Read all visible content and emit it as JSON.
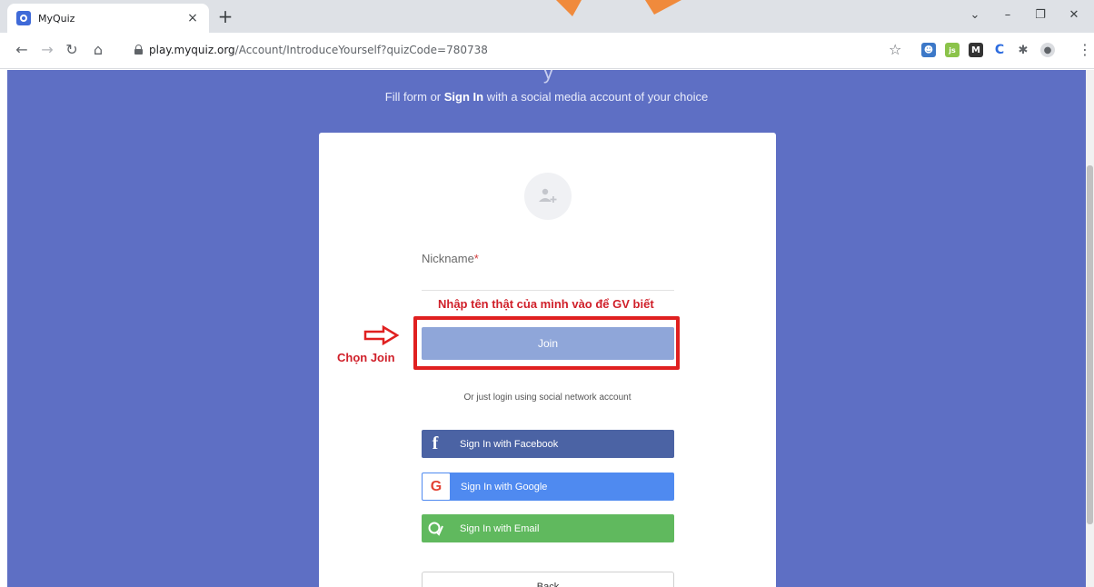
{
  "browser": {
    "tab_title": "MyQuiz",
    "tab_close": "×",
    "new_tab": "+",
    "url_host": "play.myquiz.org",
    "url_path": "/Account/IntroduceYourself?quizCode=780738",
    "window_controls": [
      "⌄",
      "–",
      "❐",
      "✕"
    ],
    "nav_icons": [
      "back-icon",
      "forward-icon",
      "reload-icon",
      "home-icon"
    ],
    "extensions": [
      "person-ext-icon",
      "js-ext-icon",
      "m-ext-icon",
      "c-ext-icon",
      "puzzle-ext-icon",
      "profile-icon"
    ]
  },
  "page": {
    "subtitle_before": "Fill form or ",
    "subtitle_bold": "Sign In",
    "subtitle_after": " with a social media account of your choice",
    "nickname_label": "Nickname",
    "required_mark": "*",
    "nickname_value": "",
    "join_label": "Join",
    "or_text": "Or just login using social network account",
    "facebook_label": "Sign In with Facebook",
    "google_label": "Sign In with Google",
    "email_label": "Sign In with Email",
    "back_label": "Back",
    "facebook_glyph": "f",
    "google_glyph": "G"
  },
  "annotations": {
    "hint": "Nhập tên thật của mình vào để GV biết",
    "chon_join": "Chọn Join"
  },
  "colors": {
    "page_bg": "#5e6fc4",
    "join_bg": "#8fa6d9",
    "facebook": "#4b63a4",
    "google": "#4f8af0",
    "email": "#60b95e",
    "annotation_red": "#e02020"
  }
}
